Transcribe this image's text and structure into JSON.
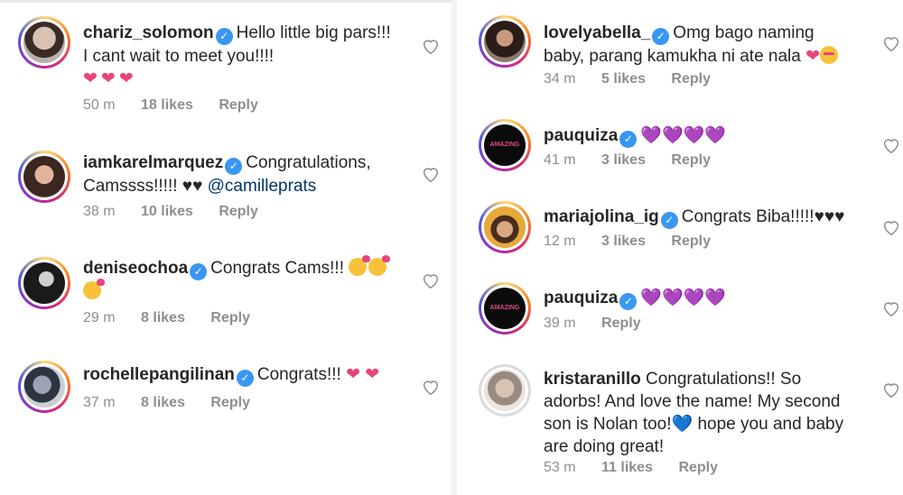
{
  "left": [
    {
      "user": "chariz_solomon",
      "verified": true,
      "text": "Hello little big pars!!! I cant wait to meet you!!!!",
      "emoji": "❤❤❤",
      "time": "50 m",
      "likes": "18 likes",
      "reply": "Reply"
    },
    {
      "user": "iamkarelmarquez",
      "verified": true,
      "text": "Congratulations, Camssss!!!!! ♥♥",
      "mention": "@camilleprats",
      "time": "38 m",
      "likes": "10 likes",
      "reply": "Reply"
    },
    {
      "user": "deniseochoa",
      "verified": true,
      "text": "Congrats Cams!!!",
      "time": "29 m",
      "likes": "8 likes",
      "reply": "Reply"
    },
    {
      "user": "rochellepangilinan",
      "verified": true,
      "text": "Congrats!!!",
      "emoji": "❤ ❤",
      "time": "37 m",
      "likes": "8 likes",
      "reply": "Reply"
    }
  ],
  "right": [
    {
      "user": "lovelyabella_",
      "verified": true,
      "text": "Omg bago naming baby, parang kamukha ni ate nala",
      "emoji": "❤",
      "time": "34 m",
      "likes": "5 likes",
      "reply": "Reply"
    },
    {
      "user": "pauquiza",
      "verified": true,
      "emoji": "💜💜💜💜",
      "avatar_text": "AMAZING BODY",
      "time": "41 m",
      "likes": "3 likes",
      "reply": "Reply"
    },
    {
      "user": "mariajolina_ig",
      "verified": true,
      "text": "Congrats Biba!!!!!♥♥♥",
      "time": "12 m",
      "likes": "3 likes",
      "reply": "Reply"
    },
    {
      "user": "pauquiza",
      "verified": true,
      "emoji": "💜💜💜💜",
      "avatar_text": "AMAZING BODY",
      "time": "39 m",
      "reply": "Reply"
    },
    {
      "user": "kristaranillo",
      "verified": false,
      "text": "Congratulations!! So adorbs! And love the name! My second son is Nolan too!",
      "text2": "hope you and baby are doing great!",
      "emoji": "💙",
      "time": "53 m",
      "likes": "11 likes",
      "reply": "Reply"
    }
  ],
  "icons": {
    "verified": "verified-badge-icon",
    "like": "heart-outline-icon"
  },
  "colors": {
    "verified": "#3897f0",
    "heart_pink": "#e8457a",
    "heart_purple": "#8a3cd6",
    "meta": "#8e8e8e"
  }
}
